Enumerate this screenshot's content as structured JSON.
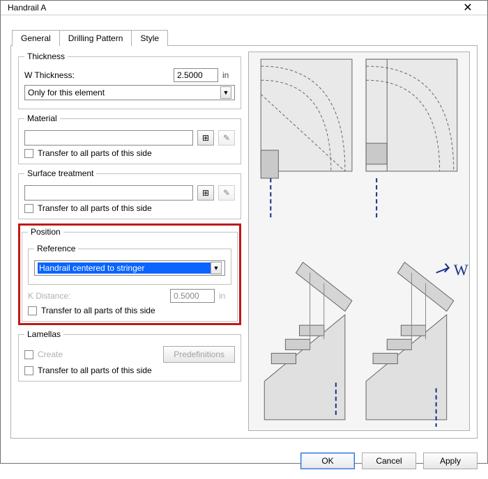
{
  "window": {
    "title": "Handrail A"
  },
  "tabs": [
    {
      "label": "General",
      "active": true
    },
    {
      "label": "Drilling Pattern"
    },
    {
      "label": "Style"
    }
  ],
  "thickness": {
    "legend": "Thickness",
    "label": "W Thickness:",
    "value": "2.5000",
    "unit": "in",
    "scope": "Only for this element"
  },
  "material": {
    "legend": "Material",
    "value": "",
    "transfer_label": "Transfer to all parts of this side"
  },
  "surface": {
    "legend": "Surface treatment",
    "value": "",
    "transfer_label": "Transfer to all parts of this side"
  },
  "position": {
    "legend": "Position",
    "reference_legend": "Reference",
    "reference_value": "Handrail centered to stringer",
    "k_label": "K Distance:",
    "k_value": "0.5000",
    "k_unit": "in",
    "transfer_label": "Transfer to all parts of this side"
  },
  "lamellas": {
    "legend": "Lamellas",
    "create_label": "Create",
    "predef_label": "Predefinitions",
    "transfer_label": "Transfer to all parts of this side"
  },
  "preview": {
    "w_label": "W"
  },
  "actions": {
    "ok": "OK",
    "cancel": "Cancel",
    "apply": "Apply"
  },
  "icons": {
    "grid": "⊞",
    "pencil": "✎",
    "dropdown": "▼"
  }
}
